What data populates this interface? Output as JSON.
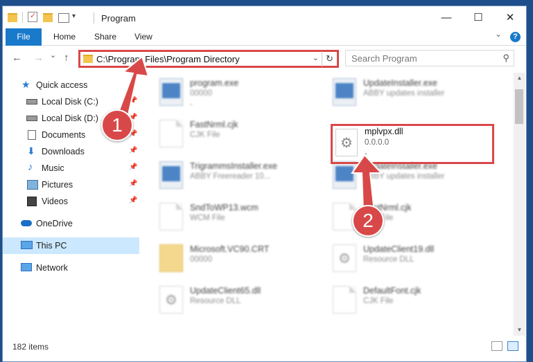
{
  "window": {
    "title": "Program",
    "controls": {
      "minimize": "—",
      "maximize": "☐",
      "close": "✕"
    }
  },
  "ribbon": {
    "tabs": [
      "File",
      "Home",
      "Share",
      "View"
    ],
    "expand": "⌄",
    "help": "?"
  },
  "nav": {
    "back": "←",
    "forward": "→",
    "recent": "⌄",
    "up": "↑",
    "address": "C:\\Program Files\\Program Directory",
    "address_dropdown": "⌄",
    "refresh": "↻",
    "search_placeholder": "Search Program",
    "search_icon": "⚲"
  },
  "sidebar": {
    "quick_access": "Quick access",
    "items": [
      {
        "label": "Local Disk (C:)",
        "icon": "drive-icon",
        "pinned": true
      },
      {
        "label": "Local Disk (D:)",
        "icon": "drive-icon",
        "pinned": true
      },
      {
        "label": "Documents",
        "icon": "documents-icon",
        "pinned": true
      },
      {
        "label": "Downloads",
        "icon": "downloads-icon",
        "pinned": true
      },
      {
        "label": "Music",
        "icon": "music-icon",
        "pinned": true
      },
      {
        "label": "Pictures",
        "icon": "pictures-icon",
        "pinned": true
      },
      {
        "label": "Videos",
        "icon": "videos-icon",
        "pinned": true
      }
    ],
    "onedrive": "OneDrive",
    "this_pc": "This PC",
    "network": "Network",
    "pin_glyph": "📌"
  },
  "files": [
    {
      "name": "program.exe",
      "type": "00000",
      "size": "-",
      "kind": "app"
    },
    {
      "name": "UpdateInstaller.exe",
      "type": "ABBY updates installer",
      "size": "",
      "kind": "app"
    },
    {
      "name": "FastNrml.cjk",
      "type": "CJK File",
      "size": "",
      "kind": "doc"
    },
    {
      "name": "TrigrammsInstaller.exe",
      "type": "ABBY Freereader 10...",
      "size": "",
      "kind": "app"
    },
    {
      "name": "UpdateInstaller.exe",
      "type": "ABBY updates installer",
      "size": "",
      "kind": "app"
    },
    {
      "name": "SndToWP13.wcm",
      "type": "WCM File",
      "size": "",
      "kind": "doc"
    },
    {
      "name": "FastNrml.cjk",
      "type": "CJK File",
      "size": "",
      "kind": "doc"
    },
    {
      "name": "Microsoft.VC90.CRT",
      "type": "00000",
      "size": "",
      "kind": "folder"
    },
    {
      "name": "UpdateClient19.dll",
      "type": "Resource DLL",
      "size": "",
      "kind": "gear"
    },
    {
      "name": "UpdateClient65.dll",
      "type": "Resource DLL",
      "size": "",
      "kind": "gear"
    },
    {
      "name": "DefaultFont.cjk",
      "type": "CJK File",
      "size": "",
      "kind": "doc"
    }
  ],
  "selected_file": {
    "name": "mplvpx.dll",
    "type": "0.0.0.0",
    "size": "-"
  },
  "status": {
    "items_count": "182 items"
  },
  "callouts": {
    "one": "1",
    "two": "2"
  },
  "colors": {
    "accent": "#1979ca",
    "highlight": "#d94848",
    "selected": "#cce8ff"
  }
}
